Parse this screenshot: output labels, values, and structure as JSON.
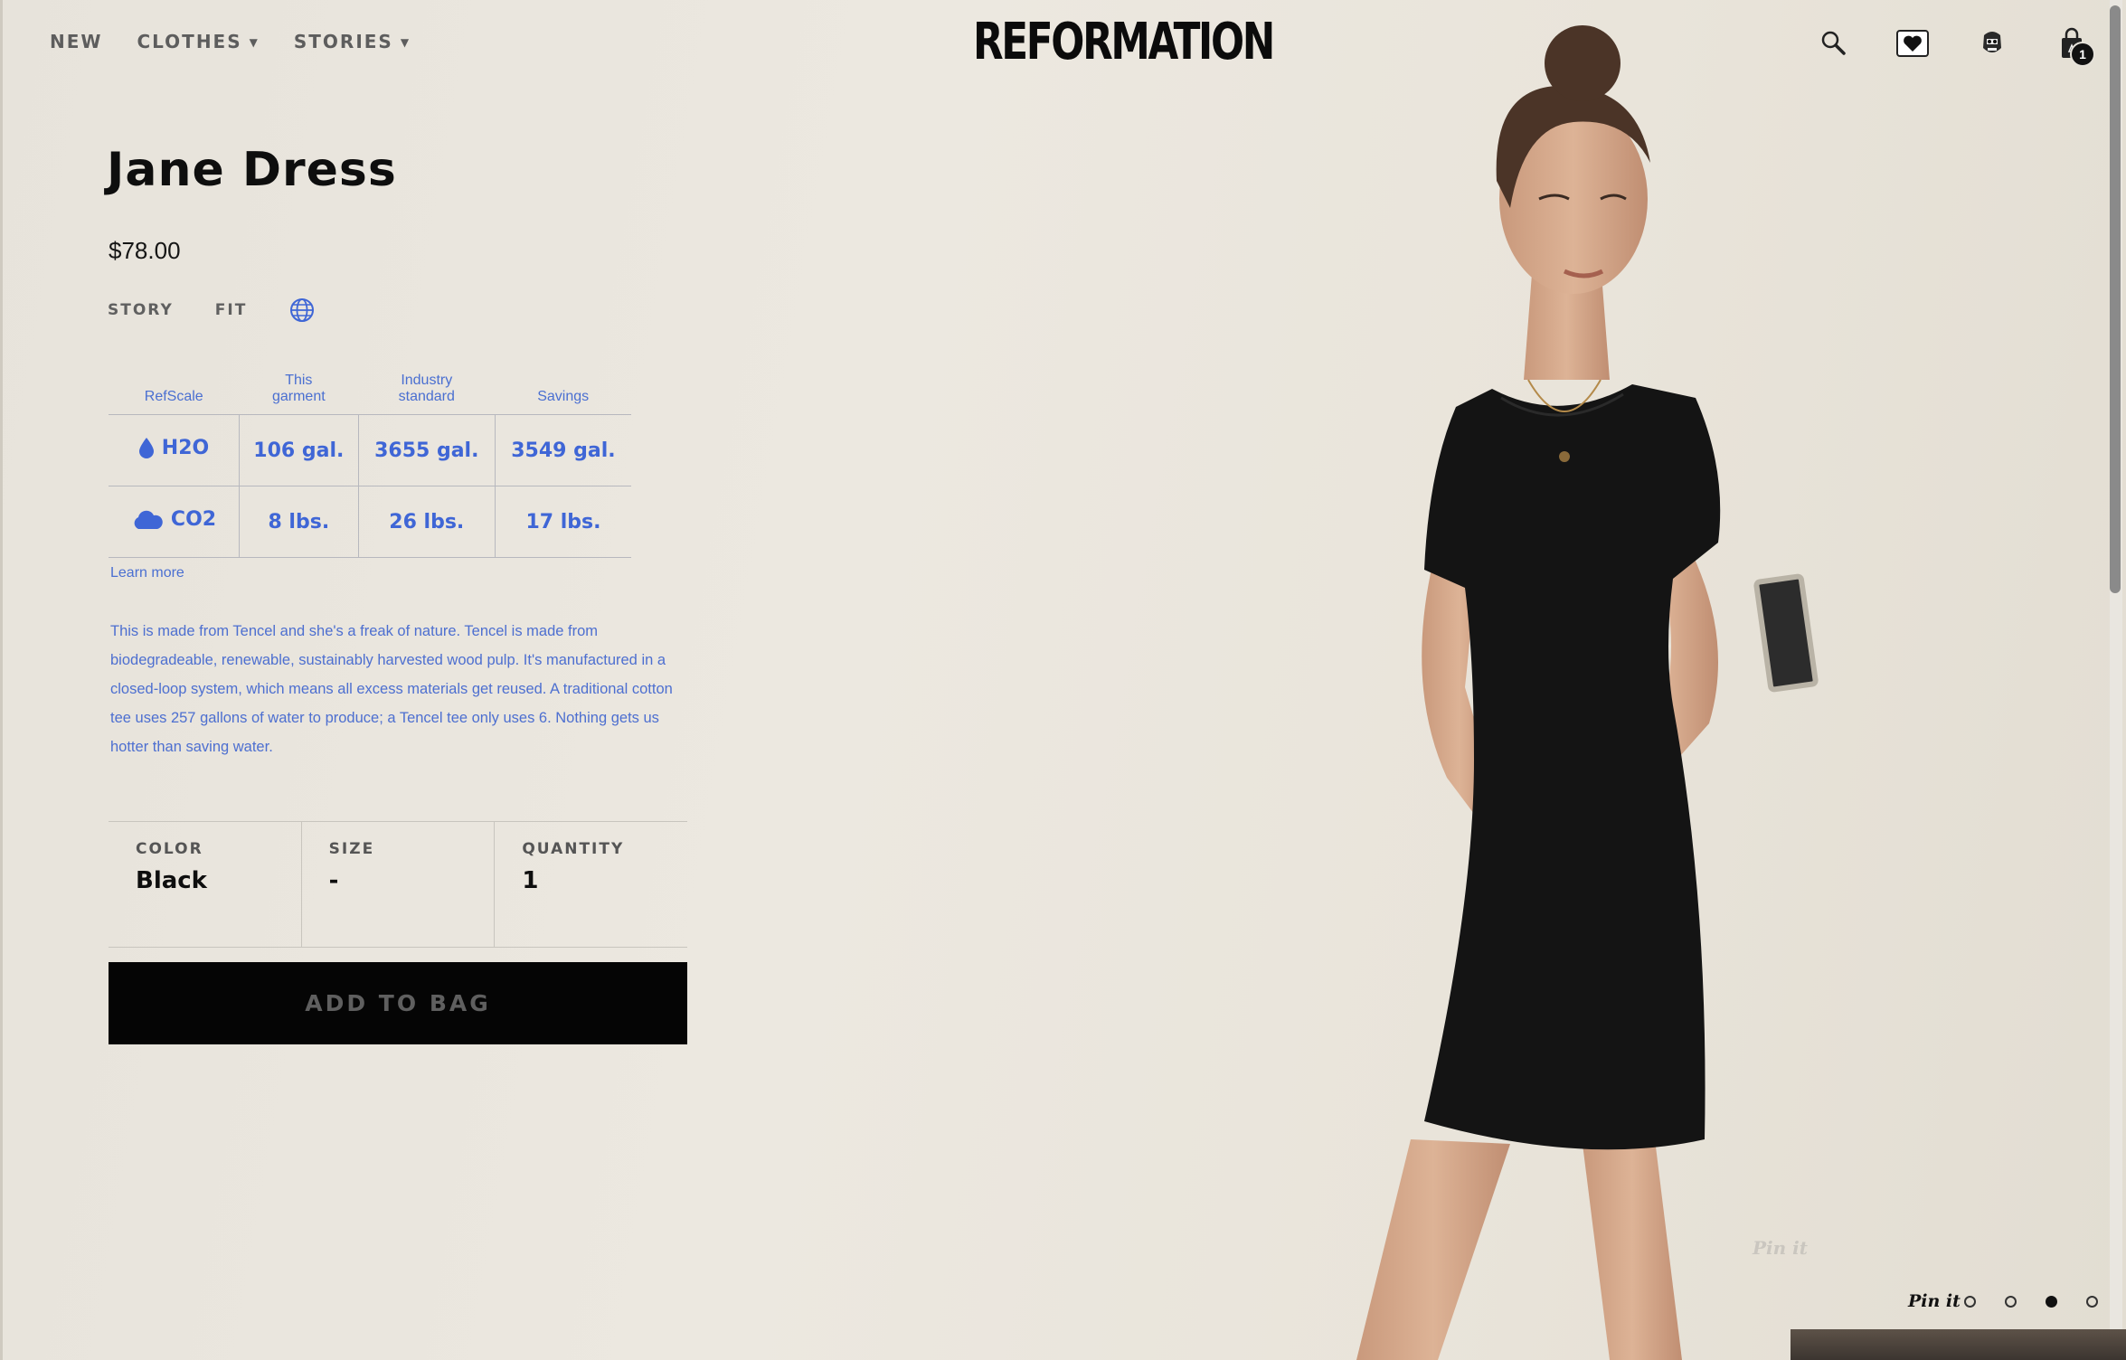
{
  "nav": {
    "items": [
      {
        "label": "NEW",
        "has_dropdown": false
      },
      {
        "label": "CLOTHES",
        "has_dropdown": true
      },
      {
        "label": "STORIES",
        "has_dropdown": true
      }
    ],
    "logo": "REFORMATION",
    "icons": [
      "search-icon",
      "wishlist-heart-icon",
      "account-icon",
      "bag-icon"
    ],
    "bag_count": "1"
  },
  "product": {
    "name": "Jane Dress",
    "price": "$78.00",
    "tabs": [
      "STORY",
      "FIT"
    ],
    "globe_icon": "globe-icon"
  },
  "refscale": {
    "headers": [
      "RefScale",
      "This garment",
      "Industry standard",
      "Savings"
    ],
    "rows": [
      {
        "metric": "H2O",
        "icon": "water-drop-icon",
        "garment": "106 gal.",
        "industry": "3655 gal.",
        "savings": "3549 gal."
      },
      {
        "metric": "CO2",
        "icon": "cloud-icon",
        "garment": "8 lbs.",
        "industry": "26 lbs.",
        "savings": "17 lbs."
      }
    ],
    "learn_more": "Learn more",
    "accent_color": "#3f66d6"
  },
  "description": "This is made from Tencel and she's a freak of nature. Tencel is made from biodegradeable, renewable, sustainably harvested wood pulp. It's manufactured in a closed-loop system, which means all excess materials get reused. A traditional cotton tee uses 257 gallons of water to produce; a Tencel tee only uses 6. Nothing gets us hotter than saving water.",
  "options": {
    "color": {
      "label": "COLOR",
      "value": "Black"
    },
    "size": {
      "label": "SIZE",
      "value": "-"
    },
    "quantity": {
      "label": "QUANTITY",
      "value": "1"
    }
  },
  "add_to_bag": "ADD TO BAG",
  "gallery": {
    "pinit": "Pin it",
    "pin_overlay": "Pin it",
    "dots": 4,
    "active_dot": 3
  }
}
